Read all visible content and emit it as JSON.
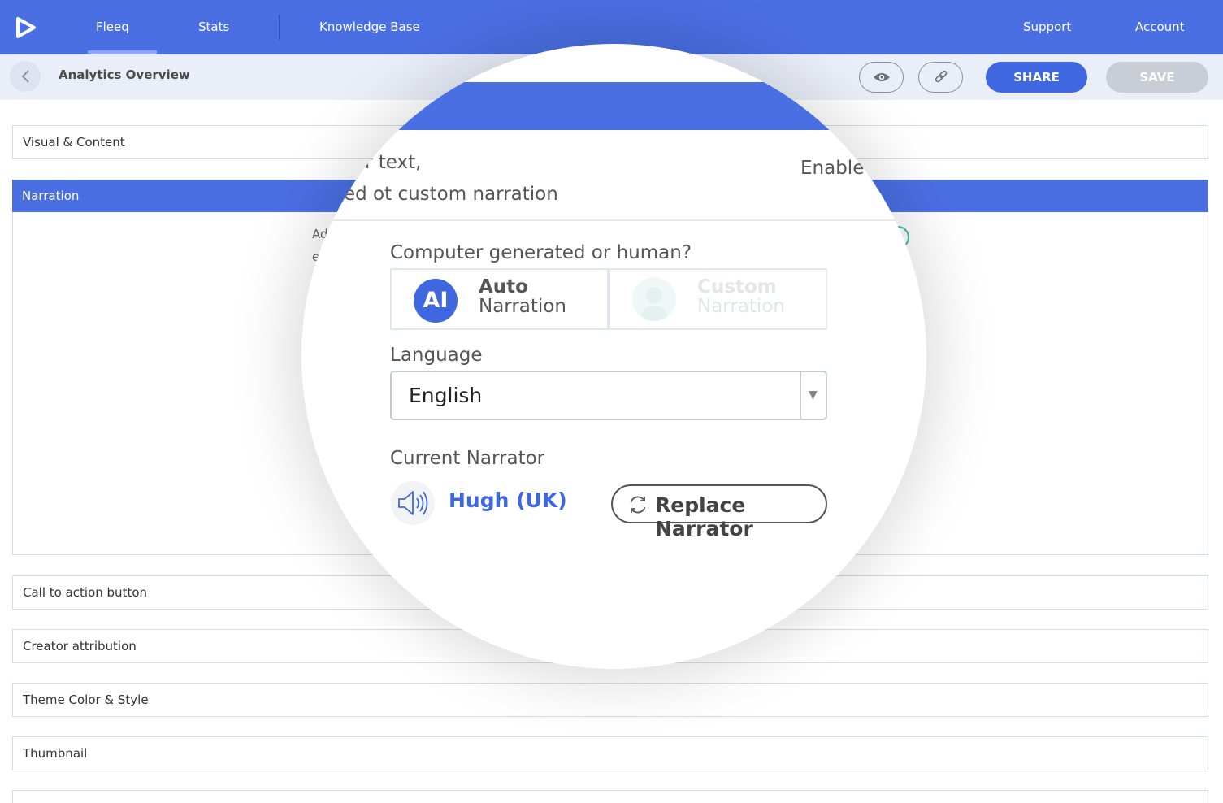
{
  "nav": {
    "items": [
      "Fleeq",
      "Stats",
      "Knowledge Base"
    ],
    "right_items": [
      "Support",
      "Account"
    ],
    "active": "Fleeq"
  },
  "subbar": {
    "title": "Analytics Overview",
    "share_label": "SHARE",
    "save_label": "SAVE"
  },
  "panels": {
    "visual": "Visual & Content",
    "narration": "Narration",
    "cta": "Call to action button",
    "creator": "Creator attribution",
    "theme": "Theme Color & Style",
    "thumbnail": "Thumbnail"
  },
  "background_fragments": {
    "ad": "Ad",
    "e": "e"
  },
  "magnifier": {
    "header_text_1": "r text,",
    "header_text_2": "ed ot custom narration",
    "enable_text": "Enable .",
    "question": "Computer generated or human?",
    "auto": {
      "badge": "AI",
      "title": "Auto",
      "subtitle": "Narration"
    },
    "custom": {
      "title": "Custom",
      "subtitle": "Narration"
    },
    "language_label": "Language",
    "language_value": "English",
    "current_narrator_label": "Current Narrator",
    "narrator_name": "Hugh (UK)",
    "replace_label": "Replace Narrator"
  },
  "colors": {
    "primary": "#4a6fe3",
    "button_blue": "#3f67e0",
    "disabled": "#c8cdd6",
    "subbar_bg": "#eaeef9"
  }
}
